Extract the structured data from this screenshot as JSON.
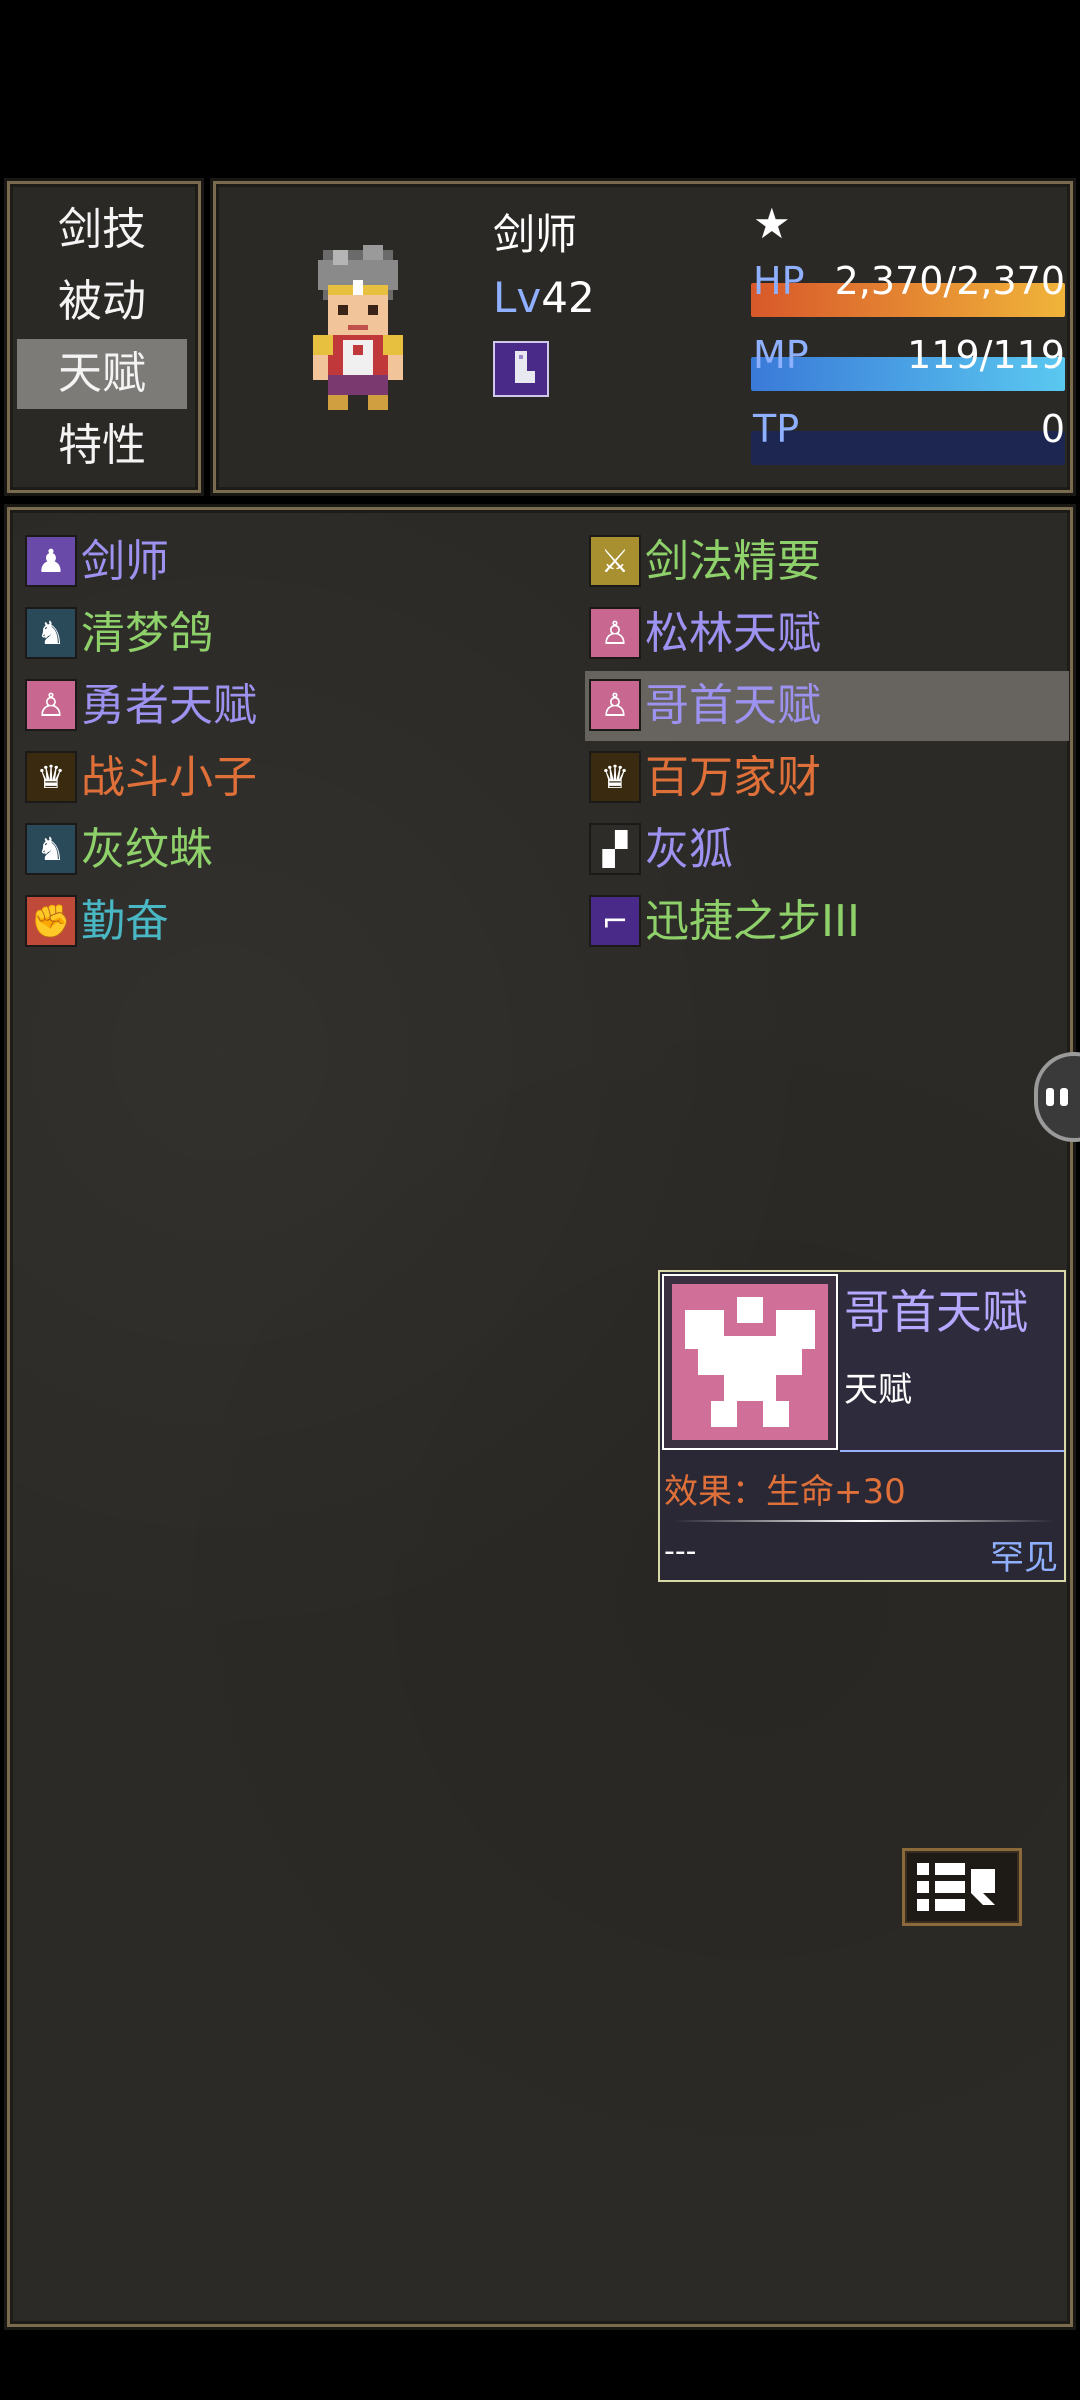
{
  "menu": {
    "items": [
      {
        "label": "剑技"
      },
      {
        "label": "被动"
      },
      {
        "label": "天赋",
        "selected": true
      },
      {
        "label": "特性"
      }
    ]
  },
  "status": {
    "class_name": "剑师",
    "star": "★",
    "level_prefix": "Lv",
    "level": "42",
    "hp_label": "HP",
    "hp_value": "2,370/2,370",
    "hp_fraction": 1.0,
    "mp_label": "MP",
    "mp_value": "119/119",
    "mp_fraction": 1.0,
    "tp_label": "TP",
    "tp_value": "0",
    "tp_fraction": 0.0
  },
  "talents": [
    {
      "label": "剑师",
      "icon": "hooded-figure-icon",
      "color": "purple"
    },
    {
      "label": "剑法精要",
      "icon": "sword-book-icon",
      "color": "green"
    },
    {
      "label": "清梦鸽",
      "icon": "horse-head-icon",
      "color": "green"
    },
    {
      "label": "松林天赋",
      "icon": "muscle-icon",
      "color": "purple"
    },
    {
      "label": "勇者天赋",
      "icon": "muscle-icon",
      "color": "purple"
    },
    {
      "label": "哥首天赋",
      "icon": "muscle-icon",
      "color": "purple",
      "selected": true
    },
    {
      "label": "战斗小子",
      "icon": "crown-icon",
      "color": "orange"
    },
    {
      "label": "百万家财",
      "icon": "crown-icon",
      "color": "orange"
    },
    {
      "label": "灰纹蛛",
      "icon": "horse-head-icon",
      "color": "green"
    },
    {
      "label": "灰狐",
      "icon": "wolf-icon",
      "color": "purple"
    },
    {
      "label": "勤奋",
      "icon": "flexing-arm-icon",
      "color": "teal"
    },
    {
      "label": "迅捷之步III",
      "icon": "boot-icon",
      "color": "green"
    }
  ],
  "detail": {
    "title": "哥首天赋",
    "type": "天赋",
    "effect_label": "效果：",
    "effect_value": "生命+30",
    "footer_left": "---",
    "rarity": "罕见",
    "icon": "muscle-icon"
  },
  "colors": {
    "purple": "#9d92f0",
    "green": "#8ed06a",
    "orange": "#e0703a",
    "teal": "#49b7c4",
    "hp_bar": "#e8883a",
    "mp_bar": "#3d8ee0",
    "tp_bar": "#263360"
  }
}
